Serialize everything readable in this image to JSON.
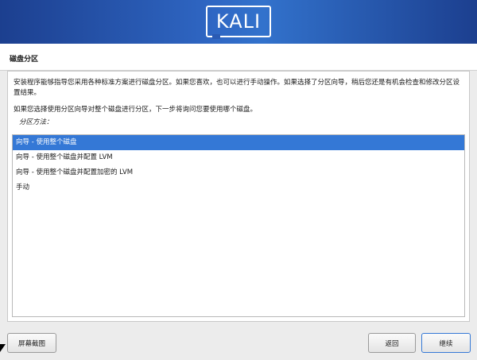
{
  "brand": {
    "logo_text": "KALI"
  },
  "page": {
    "heading": "磁盘分区"
  },
  "content": {
    "intro": "安装程序能够指导您采用各种标准方案进行磁盘分区。如果您喜欢，也可以进行手动操作。如果选择了分区向导，稍后您还是有机会检查和修改分区设置结果。",
    "prompt": "如果您选择使用分区向导对整个磁盘进行分区，下一步将询问您要使用哪个磁盘。",
    "list_label": "分区方法："
  },
  "options": [
    {
      "label": "向导 - 使用整个磁盘",
      "selected": true
    },
    {
      "label": "向导 - 使用整个磁盘并配置 LVM",
      "selected": false
    },
    {
      "label": "向导 - 使用整个磁盘并配置加密的 LVM",
      "selected": false
    },
    {
      "label": "手动",
      "selected": false
    }
  ],
  "buttons": {
    "screenshot": "屏幕截图",
    "back": "返回",
    "continue": "继续"
  },
  "colors": {
    "banner": "#2f67c4",
    "selection": "#3478d6"
  }
}
